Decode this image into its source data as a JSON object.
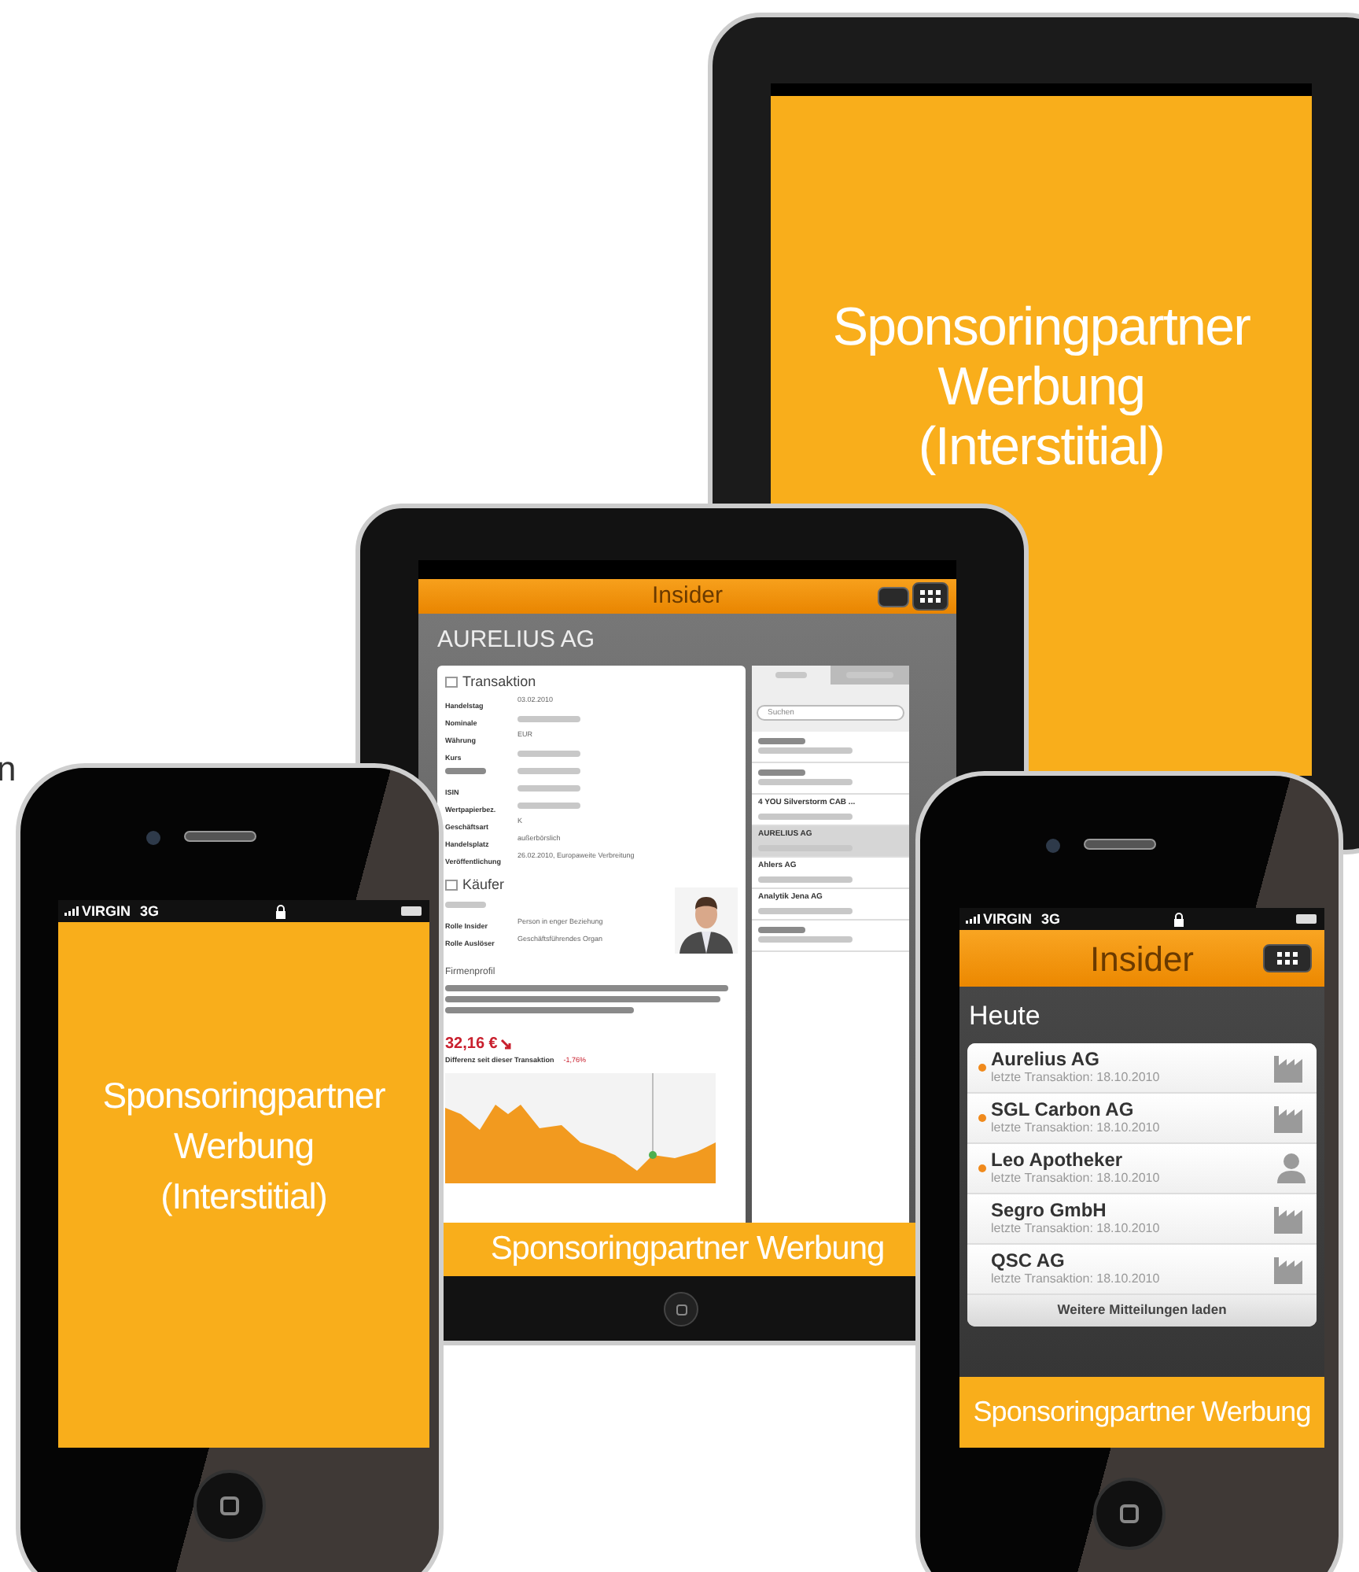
{
  "edge_fragment": "n",
  "tablet_ad": {
    "ad_lines": [
      "Sponsoringpartner",
      "Werbung",
      "(Interstitial)"
    ]
  },
  "tablet_app": {
    "title": "Insider",
    "company": "AURELIUS AG",
    "transaction": {
      "heading": "Transaktion",
      "rows": [
        {
          "label": "Handelstag",
          "value": "03.02.2010"
        },
        {
          "label": "Nominale"
        },
        {
          "label": "Währung",
          "value": "EUR"
        },
        {
          "label": "Kurs"
        },
        {},
        {
          "label": "ISIN"
        },
        {
          "label": "Wertpapierbez."
        },
        {
          "label": "Geschäftsart",
          "value": "K"
        },
        {
          "label": "Handelsplatz",
          "value": "außerbörslich"
        },
        {
          "label": "Veröffentlichung",
          "value": "26.02.2010, Europaweite Verbreitung"
        }
      ]
    },
    "buyer": {
      "heading": "Käufer",
      "rows": [
        {},
        {
          "label": "Rolle Insider",
          "value": "Person in enger Beziehung"
        },
        {
          "label": "Rolle Auslöser",
          "value": "Geschäftsführendes Organ"
        }
      ]
    },
    "profile": {
      "heading": "Firmenprofil"
    },
    "price": "32,16 €",
    "difference_label": "Differenz seit dieser Transaktion",
    "difference": "-1,76%",
    "list_search": {
      "placeholder": "Suchen"
    },
    "list": [
      {
        "selected": false
      },
      {
        "selected": false
      },
      {
        "name": "4 YOU Silverstorm CAB ...",
        "selected": false
      },
      {
        "name": "AURELIUS AG",
        "selected": true
      },
      {
        "name": "Ahlers AG",
        "selected": false
      },
      {
        "name": "Analytik Jena AG",
        "selected": false
      },
      {
        "selected": false
      }
    ],
    "banner": "Sponsoringpartner Werbung"
  },
  "phone_ad": {
    "carrier": "VIRGIN",
    "network": "3G",
    "ad_lines": [
      "Sponsoringpartner",
      "Werbung",
      "(Interstitial)"
    ]
  },
  "phone_app": {
    "carrier": "VIRGIN",
    "network": "3G",
    "title": "Insider",
    "section": "Heute",
    "items": [
      {
        "name": "Aurelius AG",
        "subtitle": "letzte Transaktion: 18.10.2010",
        "unread": true,
        "kind": "company"
      },
      {
        "name": "SGL Carbon AG",
        "subtitle": "letzte Transaktion: 18.10.2010",
        "unread": true,
        "kind": "company"
      },
      {
        "name": "Leo Apotheker",
        "subtitle": "letzte Transaktion: 18.10.2010",
        "unread": true,
        "kind": "person"
      },
      {
        "name": "Segro GmbH",
        "subtitle": "letzte Transaktion: 18.10.2010",
        "unread": false,
        "kind": "company"
      },
      {
        "name": "QSC AG",
        "subtitle": "letzte Transaktion: 18.10.2010",
        "unread": false,
        "kind": "company"
      }
    ],
    "load_more": "Weitere Mitteilungen laden",
    "banner": "Sponsoringpartner Werbung"
  }
}
